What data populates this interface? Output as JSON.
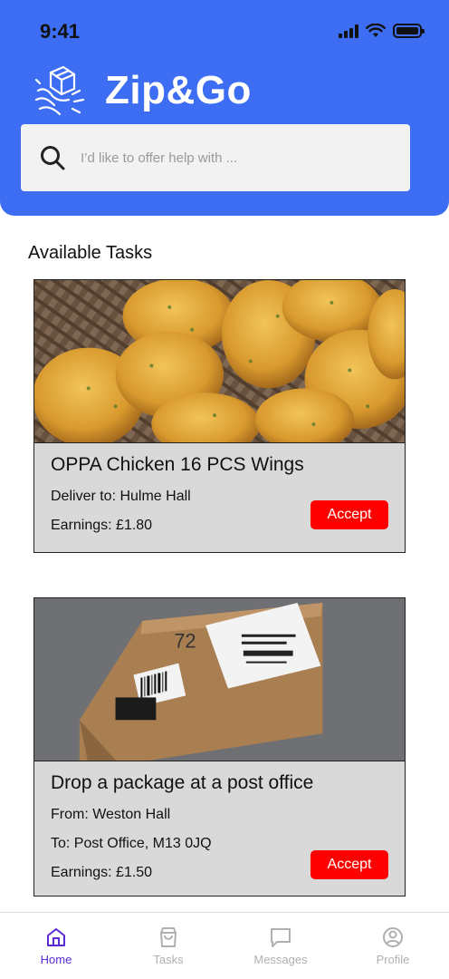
{
  "status_bar": {
    "time": "9:41"
  },
  "header": {
    "app_name": "Zip&Go"
  },
  "search": {
    "placeholder": "I’d like to offer help with ..."
  },
  "section": {
    "title": "Available Tasks"
  },
  "tasks": [
    {
      "image": "fried-chicken-photo",
      "title": "OPPA Chicken 16 PCS Wings",
      "lines": [
        "Deliver to: Hulme Hall",
        "Earnings: £1.80"
      ],
      "accept_label": "Accept"
    },
    {
      "image": "cardboard-package-photo",
      "title": "Drop a package at a post office",
      "lines": [
        "From: Weston Hall",
        "To: Post Office, M13 0JQ",
        "Earnings: £1.50"
      ],
      "accept_label": "Accept"
    }
  ],
  "nav": {
    "items": [
      {
        "label": "Home",
        "icon": "home-icon",
        "active": true
      },
      {
        "label": "Tasks",
        "icon": "bag-icon",
        "active": false
      },
      {
        "label": "Messages",
        "icon": "message-icon",
        "active": false
      },
      {
        "label": "Profile",
        "icon": "profile-icon",
        "active": false
      }
    ]
  },
  "colors": {
    "brand": "#3d6df2",
    "accept": "#ff0000",
    "nav_active": "#5a2bd6",
    "card_bg": "#d9d9d9"
  }
}
